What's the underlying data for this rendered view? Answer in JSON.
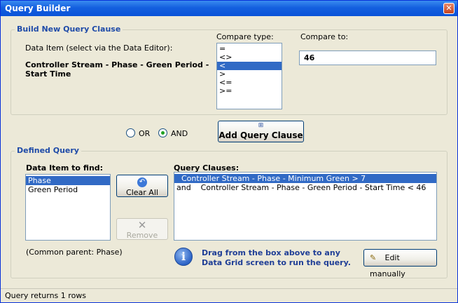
{
  "window": {
    "title": "Query Builder",
    "close_glyph": "✕"
  },
  "build": {
    "group_title": "Build New Query Clause",
    "data_item_label": "Data Item (select via the Data Editor):",
    "data_item_value_line1": "Controller Stream - Phase - Green Period -",
    "data_item_value_line2": "Start Time",
    "compare_type_label": "Compare type:",
    "compare_types": [
      "=",
      "<>",
      "<",
      ">",
      "<=",
      ">="
    ],
    "compare_types_selected_index": 2,
    "compare_to_label": "Compare to:",
    "compare_to_value": "46"
  },
  "logic": {
    "or_label": "OR",
    "and_label": "AND",
    "selected": "AND"
  },
  "add_clause_button": {
    "label": "Add Query Clause",
    "icon": "plus-icon"
  },
  "defined": {
    "group_title": "Defined Query",
    "data_item_to_find_label": "Data Item to find:",
    "data_items": [
      "Phase",
      "Green Period"
    ],
    "data_items_selected_index": 0,
    "clear_all_label": "Clear All",
    "remove_label": "Remove",
    "common_parent": "(Common parent: Phase)",
    "query_clauses_label": "Query Clauses:",
    "clauses": [
      "  Controller Stream - Phase - Minimum Green > 7",
      "and    Controller Stream - Phase - Green Period - Start Time < 46"
    ],
    "clauses_selected_index": 0,
    "hint_line1": "Drag from the box above to any",
    "hint_line2": "Data Grid screen to run the query.",
    "edit_manually_label": "Edit manually"
  },
  "status": {
    "text": "Query returns 1 rows"
  },
  "colors": {
    "title_bar": "#0A52D8",
    "group_title": "#1F4BA8",
    "selection": "#316AC5",
    "hint_text": "#1F3E96"
  }
}
